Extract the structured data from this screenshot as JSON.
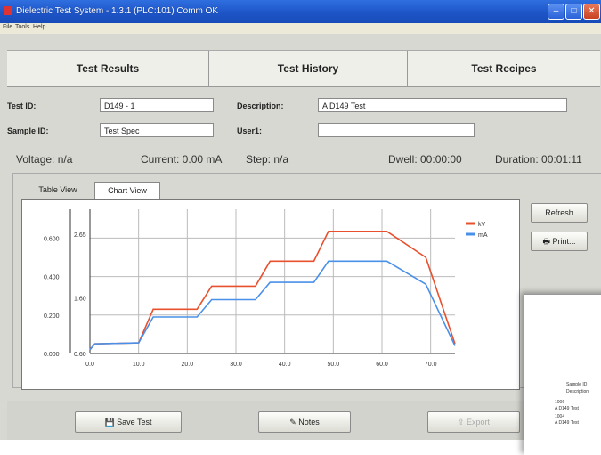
{
  "window": {
    "title": "Dielectric Test System - 1.3.1 (PLC:101) Comm OK"
  },
  "menu": [
    "File",
    "Tools",
    "Help"
  ],
  "tabs": [
    "Test Results",
    "Test History",
    "Test Recipes"
  ],
  "form": {
    "test_id_label": "Test ID:",
    "test_id_value": "D149 - 1",
    "sample_id_label": "Sample ID:",
    "sample_id_value": "Test Spec",
    "description_label": "Description:",
    "description_value": "A D149 Test",
    "user1_label": "User1:",
    "user1_value": ""
  },
  "status": {
    "voltage": "Voltage: n/a",
    "current": "Current: 0.00 mA",
    "step": "Step: n/a",
    "dwell": "Dwell: 00:00:00",
    "duration": "Duration: 00:01:11"
  },
  "view_tabs": [
    "Table View",
    "Chart View"
  ],
  "side_buttons": {
    "refresh": "Refresh",
    "print": "Print..."
  },
  "bottom_buttons": {
    "save": "Save Test",
    "notes": "Notes",
    "export": "Export"
  },
  "paper": {
    "header1": "Sample ID",
    "header2": "Description",
    "row1_id": "1006",
    "row1_desc": "A D149 Test",
    "row2_id": "1004",
    "row2_desc": "A D149 Test"
  },
  "colors": {
    "kv": "#e8502e",
    "ma": "#4a90e8"
  },
  "chart_data": {
    "type": "line",
    "x_ticks": [
      "0.0",
      "10.0",
      "20.0",
      "30.0",
      "40.0",
      "50.0",
      "60.0",
      "70.0"
    ],
    "xlim": [
      0,
      75
    ],
    "left_axis_ticks": [
      "0.000",
      "0.200",
      "0.400",
      "0.600"
    ],
    "left_ylim": [
      0,
      0.75
    ],
    "right_axis_ticks": [
      "0.60",
      "1.60",
      "2.65"
    ],
    "legend": [
      "kV",
      "mA"
    ],
    "legend_position": "top-right",
    "grid": true,
    "series": [
      {
        "name": "kV",
        "x": [
          0,
          1,
          10,
          13,
          22,
          25,
          34,
          37,
          46,
          49,
          58,
          61,
          69,
          75
        ],
        "y": [
          0.02,
          0.05,
          0.055,
          0.23,
          0.23,
          0.35,
          0.35,
          0.48,
          0.48,
          0.635,
          0.635,
          0.635,
          0.5,
          0.05
        ]
      },
      {
        "name": "mA",
        "x": [
          0,
          1,
          10,
          13,
          22,
          25,
          34,
          37,
          46,
          49,
          58,
          61,
          69,
          75
        ],
        "y": [
          0.02,
          0.05,
          0.055,
          0.19,
          0.19,
          0.28,
          0.28,
          0.37,
          0.37,
          0.48,
          0.48,
          0.48,
          0.36,
          0.04
        ]
      }
    ]
  }
}
